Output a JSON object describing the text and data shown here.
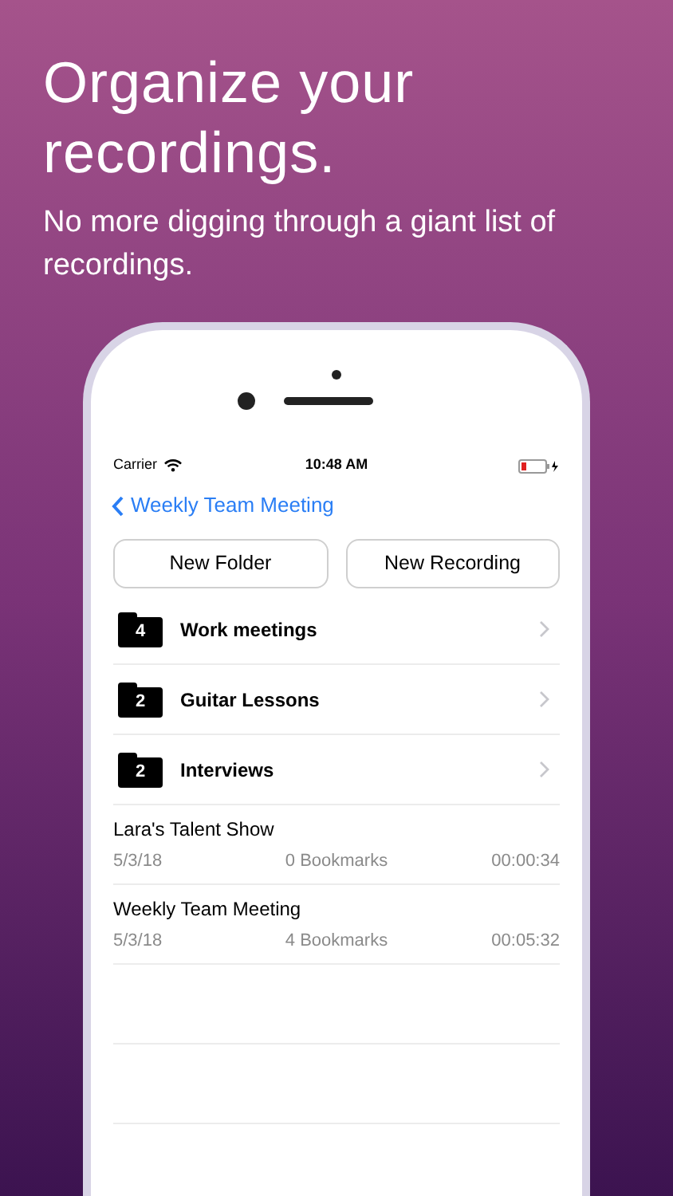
{
  "headline": "Organize your recordings.",
  "subtitle": "No more digging through a giant list of recordings.",
  "status_bar": {
    "carrier": "Carrier",
    "time": "10:48 AM"
  },
  "nav": {
    "back_label": "Weekly Team Meeting"
  },
  "buttons": [
    "New Folder",
    "New Recording"
  ],
  "folders": [
    {
      "count": "4",
      "name": "Work meetings"
    },
    {
      "count": "2",
      "name": "Guitar Lessons"
    },
    {
      "count": "2",
      "name": "Interviews"
    }
  ],
  "recordings": [
    {
      "title": "Lara's Talent Show",
      "date": "5/3/18",
      "bookmarks": "0 Bookmarks",
      "duration": "00:00:34"
    },
    {
      "title": "Weekly Team Meeting",
      "date": "5/3/18",
      "bookmarks": "4 Bookmarks",
      "duration": "00:05:32"
    }
  ]
}
